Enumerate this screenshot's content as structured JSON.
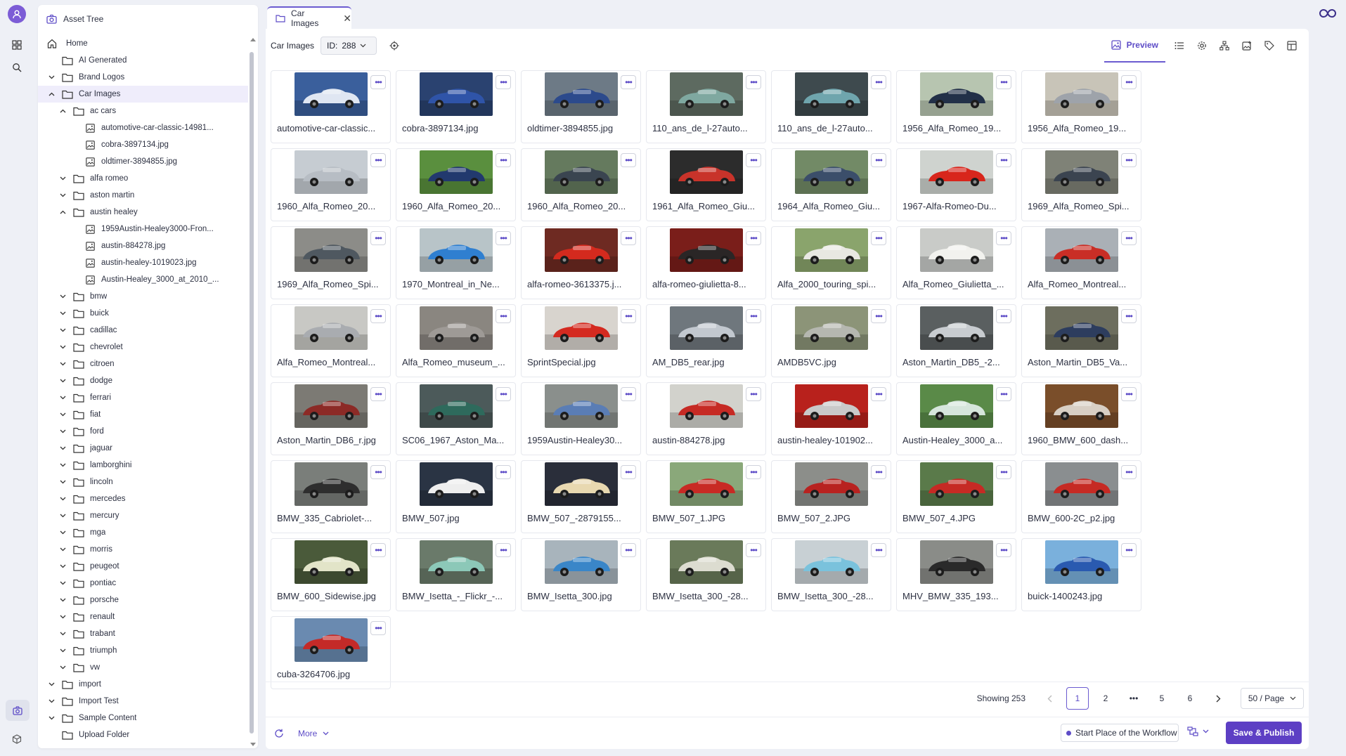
{
  "app": {
    "tab_title": "Car Images"
  },
  "tree": {
    "title": "Asset Tree",
    "items": [
      {
        "label": "Home",
        "depth": 0,
        "chevron": "",
        "icon": "home",
        "selected": false
      },
      {
        "label": "AI Generated",
        "depth": 1,
        "chevron": "",
        "icon": "folder",
        "selected": false
      },
      {
        "label": "Brand Logos",
        "depth": 1,
        "chevron": "down",
        "icon": "folder",
        "selected": false
      },
      {
        "label": "Car Images",
        "depth": 1,
        "chevron": "up",
        "icon": "folder",
        "selected": true
      },
      {
        "label": "ac cars",
        "depth": 2,
        "chevron": "up",
        "icon": "folder",
        "selected": false
      },
      {
        "label": "automotive-car-classic-14981...",
        "depth": 3,
        "chevron": "",
        "icon": "image",
        "selected": false
      },
      {
        "label": "cobra-3897134.jpg",
        "depth": 3,
        "chevron": "",
        "icon": "image",
        "selected": false
      },
      {
        "label": "oldtimer-3894855.jpg",
        "depth": 3,
        "chevron": "",
        "icon": "image",
        "selected": false
      },
      {
        "label": "alfa romeo",
        "depth": 2,
        "chevron": "down",
        "icon": "folder",
        "selected": false
      },
      {
        "label": "aston martin",
        "depth": 2,
        "chevron": "down",
        "icon": "folder",
        "selected": false
      },
      {
        "label": "austin healey",
        "depth": 2,
        "chevron": "up",
        "icon": "folder",
        "selected": false
      },
      {
        "label": "1959Austin-Healey3000-Fron...",
        "depth": 3,
        "chevron": "",
        "icon": "image",
        "selected": false
      },
      {
        "label": "austin-884278.jpg",
        "depth": 3,
        "chevron": "",
        "icon": "image",
        "selected": false
      },
      {
        "label": "austin-healey-1019023.jpg",
        "depth": 3,
        "chevron": "",
        "icon": "image",
        "selected": false
      },
      {
        "label": "Austin-Healey_3000_at_2010_...",
        "depth": 3,
        "chevron": "",
        "icon": "image",
        "selected": false
      },
      {
        "label": "bmw",
        "depth": 2,
        "chevron": "down",
        "icon": "folder",
        "selected": false
      },
      {
        "label": "buick",
        "depth": 2,
        "chevron": "down",
        "icon": "folder",
        "selected": false
      },
      {
        "label": "cadillac",
        "depth": 2,
        "chevron": "down",
        "icon": "folder",
        "selected": false
      },
      {
        "label": "chevrolet",
        "depth": 2,
        "chevron": "down",
        "icon": "folder",
        "selected": false
      },
      {
        "label": "citroen",
        "depth": 2,
        "chevron": "down",
        "icon": "folder",
        "selected": false
      },
      {
        "label": "dodge",
        "depth": 2,
        "chevron": "down",
        "icon": "folder",
        "selected": false
      },
      {
        "label": "ferrari",
        "depth": 2,
        "chevron": "down",
        "icon": "folder",
        "selected": false
      },
      {
        "label": "fiat",
        "depth": 2,
        "chevron": "down",
        "icon": "folder",
        "selected": false
      },
      {
        "label": "ford",
        "depth": 2,
        "chevron": "down",
        "icon": "folder",
        "selected": false
      },
      {
        "label": "jaguar",
        "depth": 2,
        "chevron": "down",
        "icon": "folder",
        "selected": false
      },
      {
        "label": "lamborghini",
        "depth": 2,
        "chevron": "down",
        "icon": "folder",
        "selected": false
      },
      {
        "label": "lincoln",
        "depth": 2,
        "chevron": "down",
        "icon": "folder",
        "selected": false
      },
      {
        "label": "mercedes",
        "depth": 2,
        "chevron": "down",
        "icon": "folder",
        "selected": false
      },
      {
        "label": "mercury",
        "depth": 2,
        "chevron": "down",
        "icon": "folder",
        "selected": false
      },
      {
        "label": "mga",
        "depth": 2,
        "chevron": "down",
        "icon": "folder",
        "selected": false
      },
      {
        "label": "morris",
        "depth": 2,
        "chevron": "down",
        "icon": "folder",
        "selected": false
      },
      {
        "label": "peugeot",
        "depth": 2,
        "chevron": "down",
        "icon": "folder",
        "selected": false
      },
      {
        "label": "pontiac",
        "depth": 2,
        "chevron": "down",
        "icon": "folder",
        "selected": false
      },
      {
        "label": "porsche",
        "depth": 2,
        "chevron": "down",
        "icon": "folder",
        "selected": false
      },
      {
        "label": "renault",
        "depth": 2,
        "chevron": "down",
        "icon": "folder",
        "selected": false
      },
      {
        "label": "trabant",
        "depth": 2,
        "chevron": "down",
        "icon": "folder",
        "selected": false
      },
      {
        "label": "triumph",
        "depth": 2,
        "chevron": "down",
        "icon": "folder",
        "selected": false
      },
      {
        "label": "vw",
        "depth": 2,
        "chevron": "down",
        "icon": "folder",
        "selected": false
      },
      {
        "label": "import",
        "depth": 1,
        "chevron": "down",
        "icon": "folder",
        "selected": false
      },
      {
        "label": "Import Test",
        "depth": 1,
        "chevron": "down",
        "icon": "folder",
        "selected": false
      },
      {
        "label": "Sample Content",
        "depth": 1,
        "chevron": "down",
        "icon": "folder",
        "selected": false
      },
      {
        "label": "Upload Folder",
        "depth": 1,
        "chevron": "",
        "icon": "folder",
        "selected": false
      }
    ]
  },
  "toolbar": {
    "folder_label": "Car Images",
    "id_label": "ID:",
    "id_value": "288",
    "preview_label": "Preview"
  },
  "assets": [
    {
      "name": "automotive-car-classic...",
      "bg": "#3a5f9c",
      "car": "#dfe6f2"
    },
    {
      "name": "cobra-3897134.jpg",
      "bg": "#2a4270",
      "car": "#2f54a8"
    },
    {
      "name": "oldtimer-3894855.jpg",
      "bg": "#6d7a86",
      "car": "#2c4a8c"
    },
    {
      "name": "110_ans_de_l-27auto...",
      "bg": "#5d6a60",
      "car": "#7fa8a0"
    },
    {
      "name": "110_ans_de_l-27auto...",
      "bg": "#3e4a4e",
      "car": "#6fa5ad"
    },
    {
      "name": "1956_Alfa_Romeo_19...",
      "bg": "#b7c5b0",
      "car": "#223048"
    },
    {
      "name": "1956_Alfa_Romeo_19...",
      "bg": "#c8c4b8",
      "car": "#9ea3aa"
    },
    {
      "name": "1960_Alfa_Romeo_20...",
      "bg": "#c6ccd2",
      "car": "#b7bdc4"
    },
    {
      "name": "1960_Alfa_Romeo_20...",
      "bg": "#5a8f3e",
      "car": "#22396e"
    },
    {
      "name": "1960_Alfa_Romeo_20...",
      "bg": "#657a5e",
      "car": "#3a4550"
    },
    {
      "name": "1961_Alfa_Romeo_Giu...",
      "bg": "#2c2c2c",
      "car": "#c8332a"
    },
    {
      "name": "1964_Alfa_Romeo_Giu...",
      "bg": "#728a66",
      "car": "#3b4e6a"
    },
    {
      "name": "1967-Alfa-Romeo-Du...",
      "bg": "#cfd3cf",
      "car": "#d8261c"
    },
    {
      "name": "1969_Alfa_Romeo_Spi...",
      "bg": "#7f8277",
      "car": "#3b4450"
    },
    {
      "name": "1969_Alfa_Romeo_Spi...",
      "bg": "#8c8c88",
      "car": "#4f5860"
    },
    {
      "name": "1970_Montreal_in_Ne...",
      "bg": "#b8c4c8",
      "car": "#2f7fd0"
    },
    {
      "name": "alfa-romeo-3613375.j...",
      "bg": "#6e2a22",
      "car": "#d42a1e"
    },
    {
      "name": "alfa-romeo-giulietta-8...",
      "bg": "#7a1e1a",
      "car": "#2a2626"
    },
    {
      "name": "Alfa_2000_touring_spi...",
      "bg": "#8aa46c",
      "car": "#e8e8e2"
    },
    {
      "name": "Alfa_Romeo_Giulietta_...",
      "bg": "#c9cbc8",
      "car": "#f2f2ee"
    },
    {
      "name": "Alfa_Romeo_Montreal...",
      "bg": "#aab0b6",
      "car": "#c92e26"
    },
    {
      "name": "Alfa_Romeo_Montreal...",
      "bg": "#c8c8c4",
      "car": "#a9acb0"
    },
    {
      "name": "Alfa_Romeo_museum_...",
      "bg": "#8a8680",
      "car": "#9e9a96"
    },
    {
      "name": "SprintSpecial.jpg",
      "bg": "#d8d4ce",
      "car": "#d42a20"
    },
    {
      "name": "AM_DB5_rear.jpg",
      "bg": "#6f777d",
      "car": "#c2c8cf"
    },
    {
      "name": "AMDB5VC.jpg",
      "bg": "#8c9478",
      "car": "#b5b7b0"
    },
    {
      "name": "Aston_Martin_DB5_-2...",
      "bg": "#5a5f60",
      "car": "#c8ccd0"
    },
    {
      "name": "Aston_Martin_DB5_Va...",
      "bg": "#6d6e5e",
      "car": "#2d3d5e"
    },
    {
      "name": "Aston_Martin_DB6_r.jpg",
      "bg": "#7c7a74",
      "car": "#8c2a26"
    },
    {
      "name": "SC06_1967_Aston_Ma...",
      "bg": "#4c5a5a",
      "car": "#2e6a5c"
    },
    {
      "name": "1959Austin-Healey30...",
      "bg": "#8a8f8c",
      "car": "#5a7db5"
    },
    {
      "name": "austin-884278.jpg",
      "bg": "#d2d2cc",
      "car": "#c62a24"
    },
    {
      "name": "austin-healey-101902...",
      "bg": "#b8211c",
      "car": "#c9c9c9"
    },
    {
      "name": "Austin-Healey_3000_a...",
      "bg": "#5a8a48",
      "car": "#d6e6dc"
    },
    {
      "name": "1960_BMW_600_dash...",
      "bg": "#7a4e2a",
      "car": "#d8cfc4"
    },
    {
      "name": "BMW_335_Cabriolet-...",
      "bg": "#7a7e7a",
      "car": "#2e2e2e"
    },
    {
      "name": "BMW_507.jpg",
      "bg": "#2a3444",
      "car": "#eeeeee"
    },
    {
      "name": "BMW_507_-2879155...",
      "bg": "#2a2e3a",
      "car": "#e8d8b0"
    },
    {
      "name": "BMW_507_1.JPG",
      "bg": "#8aa87a",
      "car": "#c82a24"
    },
    {
      "name": "BMW_507_2.JPG",
      "bg": "#8c8e8a",
      "car": "#b82220"
    },
    {
      "name": "BMW_507_4.JPG",
      "bg": "#5a7a4a",
      "car": "#c62a24"
    },
    {
      "name": "BMW_600-2C_p2.jpg",
      "bg": "#8a8e90",
      "car": "#c62a24"
    },
    {
      "name": "BMW_600_Sidewise.jpg",
      "bg": "#4a5a3a",
      "car": "#e2e4c8"
    },
    {
      "name": "BMW_Isetta_-_Flickr_-...",
      "bg": "#6a7a6a",
      "car": "#8cc8b8"
    },
    {
      "name": "BMW_Isetta_300.jpg",
      "bg": "#a8b4bc",
      "car": "#3a86c8"
    },
    {
      "name": "BMW_Isetta_300_-28...",
      "bg": "#6a7a5a",
      "car": "#dcdcd0"
    },
    {
      "name": "BMW_Isetta_300_-28...",
      "bg": "#c8d0d4",
      "car": "#7ac2dc"
    },
    {
      "name": "MHV_BMW_335_193...",
      "bg": "#8a8c88",
      "car": "#2a2a2a"
    },
    {
      "name": "buick-1400243.jpg",
      "bg": "#7ab0dc",
      "car": "#2a5ab0"
    },
    {
      "name": "cuba-3264706.jpg",
      "bg": "#6a8ab0",
      "car": "#c42a28"
    }
  ],
  "pagination": {
    "total": "Showing 253",
    "pages": [
      "1",
      "2",
      "•••",
      "5",
      "6"
    ],
    "current": "1",
    "page_size": "50 / Page"
  },
  "footer": {
    "more_label": "More",
    "workflow_label": "Start Place of the Workflow",
    "publish_label": "Save & Publish"
  },
  "colors": {
    "accent": "#5d3fc4",
    "selected_row": "#efedfb"
  }
}
